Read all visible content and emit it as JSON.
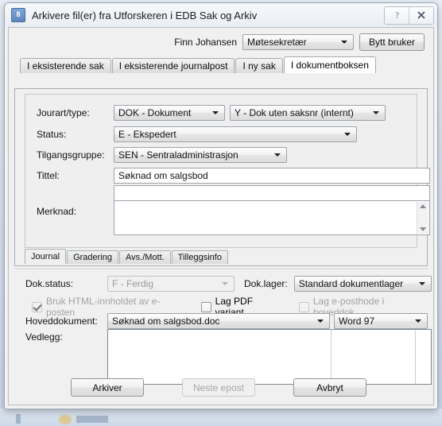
{
  "window": {
    "title": "Arkivere fil(er) fra Utforskeren i EDB Sak og Arkiv",
    "icon_label": "8",
    "help_button": "?",
    "close_button": "X"
  },
  "userbar": {
    "user_name": "Finn Johansen",
    "role_value": "Møtesekretær",
    "switch_user_label": "Bytt  bruker"
  },
  "tabs": [
    {
      "label": "I eksisterende sak",
      "active": false
    },
    {
      "label": "I eksisterende journalpost",
      "active": false
    },
    {
      "label": "I ny sak",
      "active": false
    },
    {
      "label": "I dokumentboksen",
      "active": true
    }
  ],
  "form": {
    "jourart_label": "Jourart/type:",
    "jourart_value": "DOK - Dokument",
    "jourtype_value": "Y - Dok uten saksnr (internt)",
    "status_label": "Status:",
    "status_value": "E - Ekspedert",
    "tilgangsgruppe_label": "Tilgangsgruppe:",
    "tilgangsgruppe_value": "SEN - Sentraladministrasjon",
    "tittel_label": "Tittel:",
    "tittel_value": "Søknad om salgsbod",
    "tittel2_value": "",
    "merknad_label": "Merknad:",
    "merknad_value": ""
  },
  "inner_tabs": [
    {
      "label": "Journal",
      "active": true
    },
    {
      "label": "Gradering",
      "active": false
    },
    {
      "label": "Avs./Mott.",
      "active": false
    },
    {
      "label": "Tilleggsinfo",
      "active": false
    }
  ],
  "bottom": {
    "dokstatus_label": "Dok.status:",
    "dokstatus_value": "F - Ferdig",
    "doklager_label": "Dok.lager:",
    "doklager_value": "Standard dokumentlager",
    "check_html_label": "Bruk HTML-innholdet av e-posten",
    "check_pdf_label": "Lag PDF variant",
    "check_posthode_label": "Lag e-posthode i hoveddok.",
    "hoveddokument_label": "Hoveddokument:",
    "hoveddokument_value": "Søknad om salgsbod.doc",
    "hoveddokument_format": "Word 97",
    "vedlegg_label": "Vedlegg:"
  },
  "actions": {
    "archive_label": "Arkiver",
    "next_email_label": "Neste epost",
    "cancel_label": "Avbryt"
  }
}
